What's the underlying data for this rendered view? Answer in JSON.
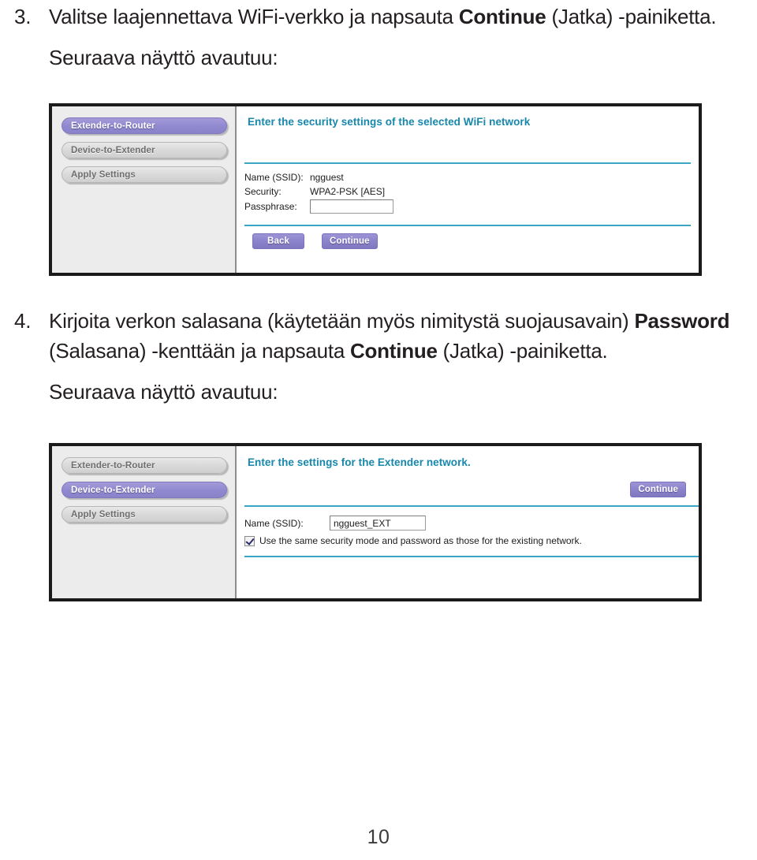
{
  "page": {
    "number": "10"
  },
  "steps": [
    {
      "number": "3.",
      "text_before_bold": "Valitse laajennettava WiFi-verkko ja napsauta ",
      "bold": "Continue",
      "text_after_bold": " (Jatka) -painiketta.",
      "followup": "Seuraava näyttö avautuu:"
    },
    {
      "number": "4.",
      "line1": "Kirjoita verkon salasana (käytetään myös nimitystä suojausavain) ",
      "bold1": "Password",
      "mid": " (Salasana) -kenttään ja napsauta ",
      "bold2": "Continue",
      "tail": " (Jatka) -painiketta.",
      "followup": "Seuraava näyttö avautuu:"
    }
  ],
  "screenshot_one": {
    "sidebar_tabs": [
      {
        "label": "Extender-to-Router",
        "active": true
      },
      {
        "label": "Device-to-Extender",
        "active": false
      },
      {
        "label": "Apply Settings",
        "active": false
      }
    ],
    "heading": "Enter the security settings of the selected WiFi network",
    "fields": [
      {
        "label": "Name (SSID):",
        "value": "ngguest"
      },
      {
        "label": "Security:",
        "value": "WPA2-PSK [AES]"
      }
    ],
    "passphrase_label": "Passphrase:",
    "passphrase_value": "",
    "buttons": [
      {
        "label": "Back"
      },
      {
        "label": "Continue"
      }
    ]
  },
  "screenshot_two": {
    "sidebar_tabs": [
      {
        "label": "Extender-to-Router",
        "active": false
      },
      {
        "label": "Device-to-Extender",
        "active": true
      },
      {
        "label": "Apply Settings",
        "active": false
      }
    ],
    "heading": "Enter the settings for the Extender network.",
    "continue_label": "Continue",
    "ssid_label": "Name (SSID):",
    "ssid_value": "ngguest_EXT",
    "checkbox_label": "Use the same security mode and password as those for the existing network.",
    "checkbox_checked": true
  },
  "colors": {
    "accent_purple": "#8b83ca",
    "heading_teal": "#1787ab",
    "rule_teal": "#3aa6c4",
    "sidebar_gray": "#ececec",
    "frame_black": "#1b1b1b",
    "body_text": "#231f20"
  }
}
